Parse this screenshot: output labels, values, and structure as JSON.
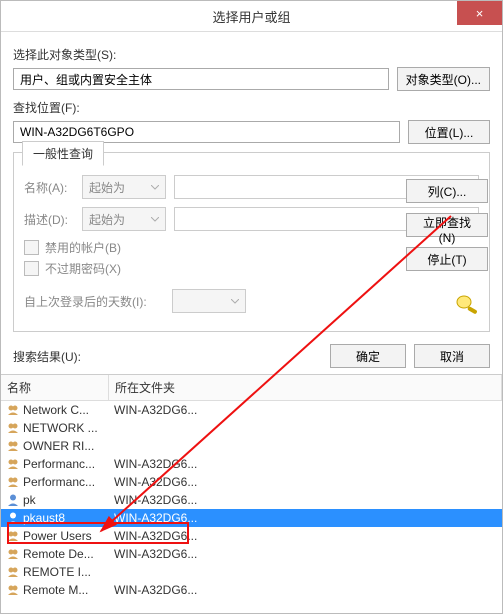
{
  "window": {
    "title": "选择用户或组",
    "close": "×"
  },
  "object_type": {
    "label": "选择此对象类型(S):",
    "value": "用户、组或内置安全主体",
    "button": "对象类型(O)..."
  },
  "location": {
    "label": "查找位置(F):",
    "value": "WIN-A32DG6T6GPO",
    "button": "位置(L)..."
  },
  "query_tab": {
    "tab_label": "一般性查询",
    "name_label": "名称(A):",
    "name_combo": "起始为",
    "desc_label": "描述(D):",
    "desc_combo": "起始为",
    "chk_disabled": "禁用的帐户(B)",
    "chk_noexpire": "不过期密码(X)",
    "days_label": "自上次登录后的天数(I):"
  },
  "right_buttons": {
    "columns": "列(C)...",
    "find_now": "立即查找(N)",
    "stop": "停止(T)"
  },
  "footer": {
    "results_label": "搜索结果(U):",
    "ok": "确定",
    "cancel": "取消"
  },
  "results": {
    "header_name": "名称",
    "header_folder": "所在文件夹",
    "rows": [
      {
        "icon": "group",
        "name": "Network C...",
        "folder": "WIN-A32DG6..."
      },
      {
        "icon": "group",
        "name": "NETWORK ...",
        "folder": ""
      },
      {
        "icon": "group",
        "name": "OWNER RI...",
        "folder": ""
      },
      {
        "icon": "group",
        "name": "Performanc...",
        "folder": "WIN-A32DG6..."
      },
      {
        "icon": "group",
        "name": "Performanc...",
        "folder": "WIN-A32DG6..."
      },
      {
        "icon": "user",
        "name": "pk",
        "folder": "WIN-A32DG6..."
      },
      {
        "icon": "user",
        "name": "pkaust8",
        "folder": "WIN-A32DG6...",
        "selected": true
      },
      {
        "icon": "group",
        "name": "Power Users",
        "folder": "WIN-A32DG6..."
      },
      {
        "icon": "group",
        "name": "Remote De...",
        "folder": "WIN-A32DG6..."
      },
      {
        "icon": "group",
        "name": "REMOTE I...",
        "folder": ""
      },
      {
        "icon": "group",
        "name": "Remote M...",
        "folder": "WIN-A32DG6..."
      }
    ]
  }
}
